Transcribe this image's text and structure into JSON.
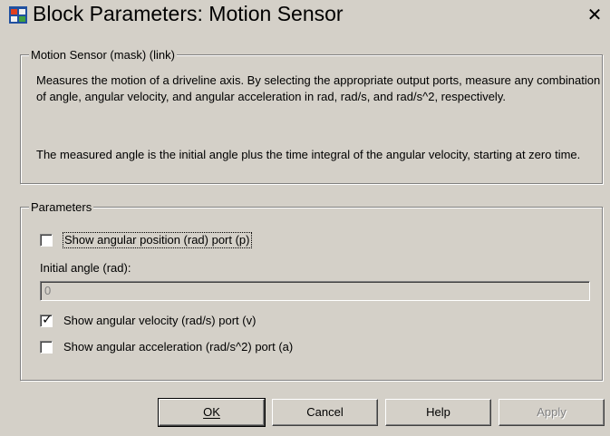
{
  "window": {
    "title": "Block Parameters: Motion Sensor",
    "close_glyph": "✕"
  },
  "description_group": {
    "legend": "Motion Sensor (mask) (link)",
    "paragraph1": "Measures the motion of a driveline axis. By selecting the appropriate output ports, measure any combination of angle, angular velocity, and angular acceleration in rad, rad/s, and rad/s^2, respectively.",
    "paragraph2": "The measured angle is the initial angle plus the time integral of the angular velocity, starting at zero time."
  },
  "parameters": {
    "legend": "Parameters",
    "show_position": {
      "label": "Show angular position (rad) port (p)",
      "checked": false
    },
    "initial_angle": {
      "label": "Initial angle (rad):",
      "value": "0",
      "enabled": false
    },
    "show_velocity": {
      "label": "Show angular velocity (rad/s) port (v)",
      "checked": true
    },
    "show_acceleration": {
      "label": "Show angular acceleration (rad/s^2) port (a)",
      "checked": false
    }
  },
  "buttons": {
    "ok": "OK",
    "cancel": "Cancel",
    "help": "Help",
    "apply": "Apply"
  },
  "colors": {
    "face": "#d4d0c8",
    "shadow": "#808080",
    "disabled_text": "#808080"
  },
  "icons": {
    "app": "simulink-block-icon",
    "close": "close-icon",
    "check": "checkmark-icon"
  }
}
